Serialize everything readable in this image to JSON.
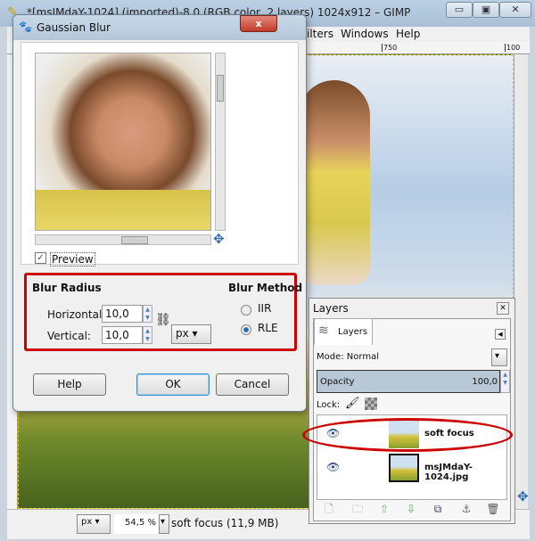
{
  "window": {
    "title": "*[msJMdaY-1024] (imported)-8.0 (RGB color, 2 layers) 1024x912 – GIMP",
    "minimize": "▭",
    "maximize": "▣",
    "close": "✕"
  },
  "menu": {
    "items": [
      "ilters",
      "Windows",
      "Help"
    ]
  },
  "ruler": {
    "mark1": "750",
    "mark2": "100"
  },
  "status": {
    "unit": "px",
    "zoom": "54,5 %",
    "info": "soft focus (11,9 MB)"
  },
  "dialog": {
    "title": "Gaussian Blur",
    "close": "x",
    "preview_label": "Preview",
    "preview_checked": true,
    "blur_radius": {
      "heading": "Blur Radius",
      "horizontal_label": "Horizontal:",
      "horizontal_value": "10,0",
      "vertical_label": "Vertical:",
      "vertical_value": "10,0",
      "unit": "px"
    },
    "blur_method": {
      "heading": "Blur Method",
      "options": [
        "IIR",
        "RLE"
      ],
      "selected": "RLE"
    },
    "buttons": {
      "help": "Help",
      "ok": "OK",
      "cancel": "Cancel"
    }
  },
  "layers": {
    "title": "Layers",
    "tab": "Layers",
    "mode_label": "Mode: Normal",
    "opacity_label": "Opacity",
    "opacity_value": "100,0",
    "lock_label": "Lock:",
    "items": [
      {
        "name": "soft focus",
        "highlighted": true
      },
      {
        "name": "msJMdaY-1024.jpg",
        "highlighted": false
      }
    ]
  },
  "colors": {
    "highlight": "#cc0000",
    "accent": "#2b6ab0"
  }
}
